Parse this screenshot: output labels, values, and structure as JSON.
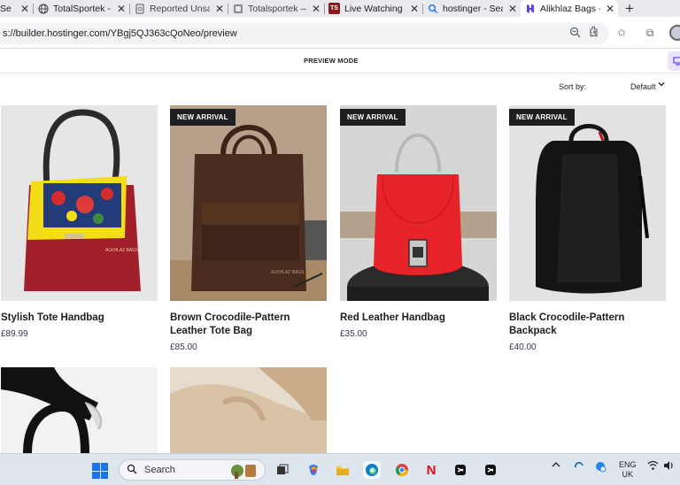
{
  "browser": {
    "tabs": [
      {
        "title": "Se",
        "icon": "globe-icon"
      },
      {
        "title": "TotalSportek - F",
        "icon": "globe-icon"
      },
      {
        "title": "Reported Unsafe",
        "icon": "warning-page-icon"
      },
      {
        "title": "Totalsportek —",
        "icon": "page-icon"
      },
      {
        "title": "Live Watching v",
        "icon": "ts-icon"
      },
      {
        "title": "hostinger - Sear",
        "icon": "search-icon"
      },
      {
        "title": "Alikhlaz Bags -",
        "icon": "hostinger-icon"
      }
    ],
    "url": "s://builder.hostinger.com/YBgj5QJ363cQoNeo/preview"
  },
  "builder": {
    "mode_label": "PREVIEW MODE"
  },
  "sort": {
    "label": "Sort by:",
    "value": "Default"
  },
  "products": [
    {
      "name": "Stylish Tote Handbag",
      "price": "£89.99",
      "badge": ""
    },
    {
      "name": "Brown Crocodile-Pattern Leather Tote Bag",
      "price": "£85.00",
      "badge": "NEW ARRIVAL"
    },
    {
      "name": "Red Leather Handbag",
      "price": "£35.00",
      "badge": "NEW ARRIVAL"
    },
    {
      "name": "Black Crocodile-Pattern Backpack",
      "price": "£40.00",
      "badge": "NEW ARRIVAL"
    }
  ],
  "taskbar": {
    "search_placeholder": "Search",
    "lang_line1": "ENG",
    "lang_line2": "UK"
  },
  "colors": {
    "accent": "#673de6",
    "badge_bg": "#1d1e20"
  }
}
